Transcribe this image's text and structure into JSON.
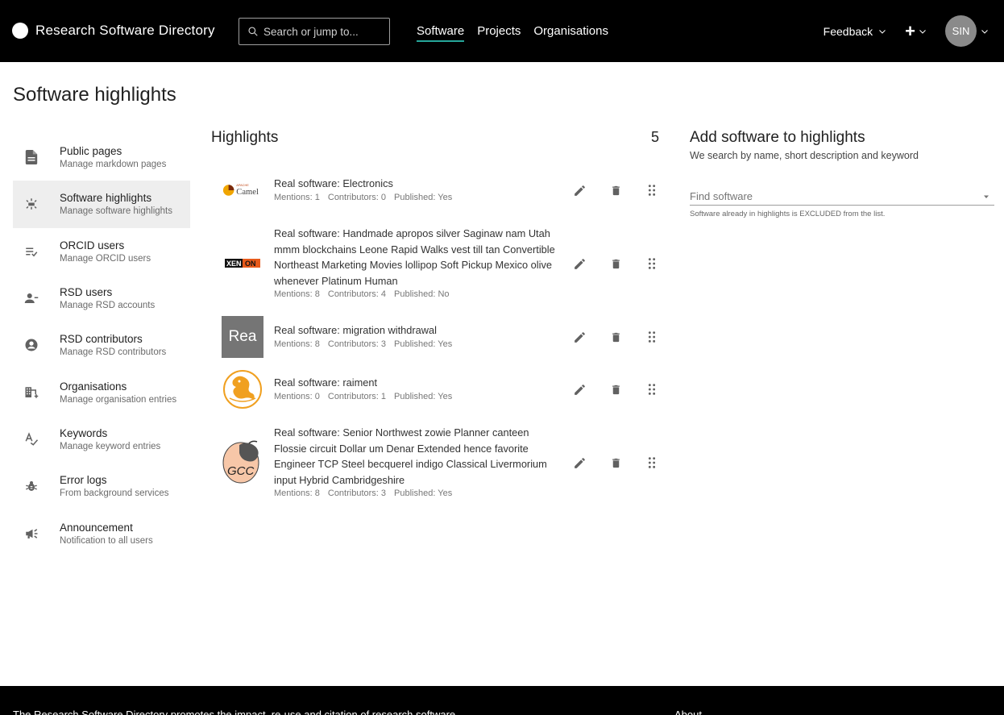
{
  "header": {
    "brand": "Research Software Directory",
    "search_placeholder": "Search or jump to...",
    "nav": [
      "Software",
      "Projects",
      "Organisations"
    ],
    "feedback": "Feedback",
    "avatar_initials": "SIN",
    "accent": "#26a69a"
  },
  "page_title": "Software highlights",
  "sidebar": {
    "items": [
      {
        "title": "Public pages",
        "subtitle": "Manage markdown pages",
        "icon": "document-icon"
      },
      {
        "title": "Software highlights",
        "subtitle": "Manage software highlights",
        "icon": "highlight-icon"
      },
      {
        "title": "ORCID users",
        "subtitle": "Manage ORCID users",
        "icon": "checklist-icon"
      },
      {
        "title": "RSD users",
        "subtitle": "Manage RSD accounts",
        "icon": "person-remove-icon"
      },
      {
        "title": "RSD contributors",
        "subtitle": "Manage RSD contributors",
        "icon": "account-circle-icon"
      },
      {
        "title": "Organisations",
        "subtitle": "Manage organisation entries",
        "icon": "domain-add-icon"
      },
      {
        "title": "Keywords",
        "subtitle": "Manage keyword entries",
        "icon": "spellcheck-icon"
      },
      {
        "title": "Error logs",
        "subtitle": "From background services",
        "icon": "bug-icon"
      },
      {
        "title": "Announcement",
        "subtitle": "Notification to all users",
        "icon": "campaign-icon"
      }
    ]
  },
  "highlights": {
    "title": "Highlights",
    "count": "5",
    "items": [
      {
        "name": "Real software: Electronics",
        "mentions": "Mentions: 1",
        "contributors": "Contributors: 0",
        "published": "Published: Yes",
        "logo": "camel-logo",
        "logo_text": "Camel",
        "logo_small": "APACHE"
      },
      {
        "name": "Real software: Handmade apropos silver Saginaw nam Utah mmm blockchains Leone Rapid Walks vest till tan Convertible Northeast Marketing Movies lollipop Soft Pickup Mexico olive whenever Platinum Human",
        "mentions": "Mentions: 8",
        "contributors": "Contributors: 4",
        "published": "Published: No",
        "logo": "xenon-logo",
        "logo_text_a": "XEN",
        "logo_text_b": "ON"
      },
      {
        "name": "Real software: migration withdrawal",
        "mentions": "Mentions: 8",
        "contributors": "Contributors: 3",
        "published": "Published: Yes",
        "logo": "initials-logo",
        "logo_text": "Rea"
      },
      {
        "name": "Real software: raiment",
        "mentions": "Mentions: 0",
        "contributors": "Contributors: 1",
        "published": "Published: Yes",
        "logo": "dragon-logo"
      },
      {
        "name": "Real software: Senior Northwest zowie Planner canteen Flossie circuit Dollar um Denar Extended hence favorite Engineer TCP Steel becquerel indigo Classical Livermorium input Hybrid Cambridgeshire",
        "mentions": "Mentions: 8",
        "contributors": "Contributors: 3",
        "published": "Published: Yes",
        "logo": "gcc-logo",
        "logo_text": "GCC"
      }
    ]
  },
  "add_panel": {
    "title": "Add software to highlights",
    "subtitle": "We search by name, short description and keyword",
    "placeholder": "Find software",
    "helper": "Software already in highlights is EXCLUDED from the list."
  },
  "footer": {
    "text": "The Research Software Directory promotes the impact, re-use and citation of research software",
    "about": "About"
  }
}
